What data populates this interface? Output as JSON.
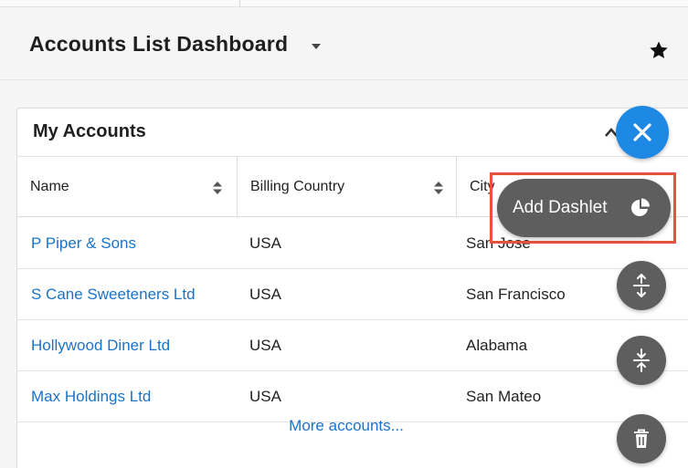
{
  "header": {
    "title": "Accounts List Dashboard"
  },
  "dashlet": {
    "title": "My Accounts",
    "columns": [
      "Name",
      "Billing Country",
      "City"
    ],
    "rows": [
      {
        "name": "P Piper & Sons",
        "country": "USA",
        "city": "San Jose"
      },
      {
        "name": "S Cane Sweeteners Ltd",
        "country": "USA",
        "city": "San Francisco"
      },
      {
        "name": "Hollywood Diner Ltd",
        "country": "USA",
        "city": "Alabama"
      },
      {
        "name": "Max Holdings Ltd",
        "country": "USA",
        "city": "San Mateo"
      }
    ],
    "more_link": "More accounts..."
  },
  "fab_menu": {
    "add_dashlet_label": "Add Dashlet"
  },
  "colors": {
    "link": "#1a73c8",
    "fab_blue": "#1e88e5",
    "fab_gray": "#5e5e5e",
    "highlight": "#e5533d"
  },
  "icons": [
    "chevron-down-icon",
    "star-icon",
    "chevron-up-icon",
    "sort-icon",
    "close-icon",
    "pie-chart-icon",
    "expand-icon",
    "collapse-icon",
    "trash-icon"
  ]
}
